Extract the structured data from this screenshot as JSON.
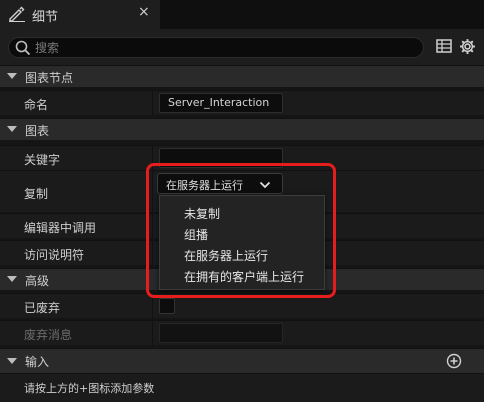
{
  "tab": {
    "title": "细节",
    "close": "×"
  },
  "search": {
    "placeholder": "搜索"
  },
  "sections": {
    "graph_node": "图表节点",
    "graph": "图表",
    "advanced": "高级",
    "inputs": "输入"
  },
  "rows": {
    "name_label": "命名",
    "name_value": "Server_Interaction",
    "keywords_label": "关键字",
    "replicate_label": "复制",
    "replicate_value": "在服务器上运行",
    "call_in_editor_label": "编辑器中调用",
    "access_specifier_label": "访问说明符",
    "deprecated_label": "已废弃",
    "deprecation_message_label": "废弃消息"
  },
  "dropdown_options": [
    "未复制",
    "组播",
    "在服务器上运行",
    "在拥有的客户端上运行"
  ],
  "inputs_hint": "请按上方的+图标添加参数",
  "colors": {
    "highlight": "#e51d1d",
    "background": "#151515"
  }
}
